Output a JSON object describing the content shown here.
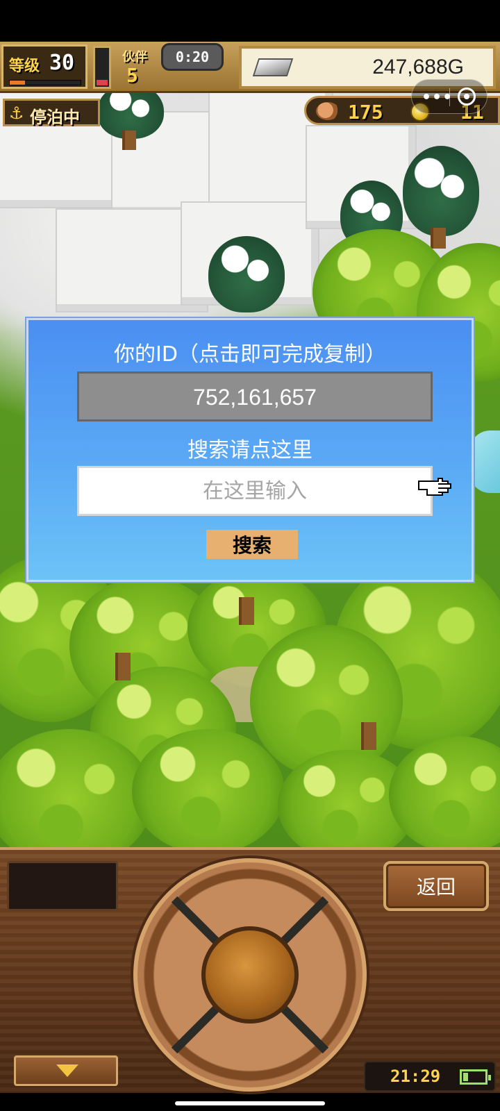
{
  "hud": {
    "level_label": "等级",
    "level_value": "30",
    "level_progress_fraction": 0.22,
    "stamina_fraction": 0.15,
    "crew_label": "伙伴",
    "crew_value": "5",
    "timer": "0:20",
    "money": "247,688G",
    "status": "停泊中",
    "food_value": "175",
    "coin_value": "11"
  },
  "dialog": {
    "id_title": "你的ID（点击即可完成复制）",
    "id_value": "752,161,657",
    "search_title": "搜索请点这里",
    "search_placeholder": "在这里输入",
    "search_button": "搜索"
  },
  "panel": {
    "back_button": "返回",
    "clock": "21:29",
    "battery_fraction": 0.2
  },
  "colors": {
    "dialog_top": "#4b8ff2",
    "dialog_bottom": "#6cc3f7",
    "search_button": "#e8b070",
    "hud_gold": "#ffd34a"
  },
  "icons": [
    "anchor-icon",
    "silver-ingot-icon",
    "food-icon",
    "coin-icon",
    "more-icon",
    "close-icon",
    "pointer-hand-icon",
    "down-arrow-icon",
    "battery-icon"
  ]
}
